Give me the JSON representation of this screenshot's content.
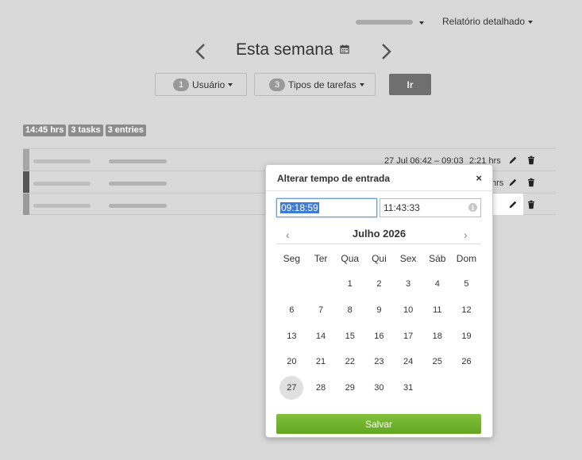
{
  "toolbar": {
    "report_menu_label": "Relatório detalhado"
  },
  "week_nav": {
    "title": "Esta semana"
  },
  "filters": {
    "user_count": "1",
    "user_label": "Usuário",
    "tasktype_count": "3",
    "tasktype_label": "Tipos de tarefas",
    "go_label": "Ir"
  },
  "stats": {
    "hours": "14:45 hrs",
    "tasks": "3 tasks",
    "entries": "3 entries"
  },
  "entries": [
    {
      "color": "#a6a6a6",
      "range": "27 Jul 06:42 – 09:03",
      "duration": "2:21 hrs"
    },
    {
      "color": "#555555",
      "duration_clipped": "hrs"
    },
    {
      "color": "#9a9a9a"
    }
  ],
  "popup": {
    "title": "Alterar tempo de entrada",
    "close": "×",
    "start_time": "09:18:59",
    "end_time": "11:43:33",
    "month_title": "Julho 2026",
    "weekdays": [
      "Seg",
      "Ter",
      "Qua",
      "Qui",
      "Sex",
      "Sáb",
      "Dom"
    ],
    "days": [
      "",
      "",
      "1",
      "2",
      "3",
      "4",
      "5",
      "6",
      "7",
      "8",
      "9",
      "10",
      "11",
      "12",
      "13",
      "14",
      "15",
      "16",
      "17",
      "18",
      "19",
      "20",
      "21",
      "22",
      "23",
      "24",
      "25",
      "26",
      "27",
      "28",
      "29",
      "30",
      "31"
    ],
    "today": "27",
    "save_label": "Salvar"
  },
  "colors": {
    "save_button": "#72b52b",
    "go_button": "#6f6f6f",
    "selection": "#3d7bd6"
  }
}
